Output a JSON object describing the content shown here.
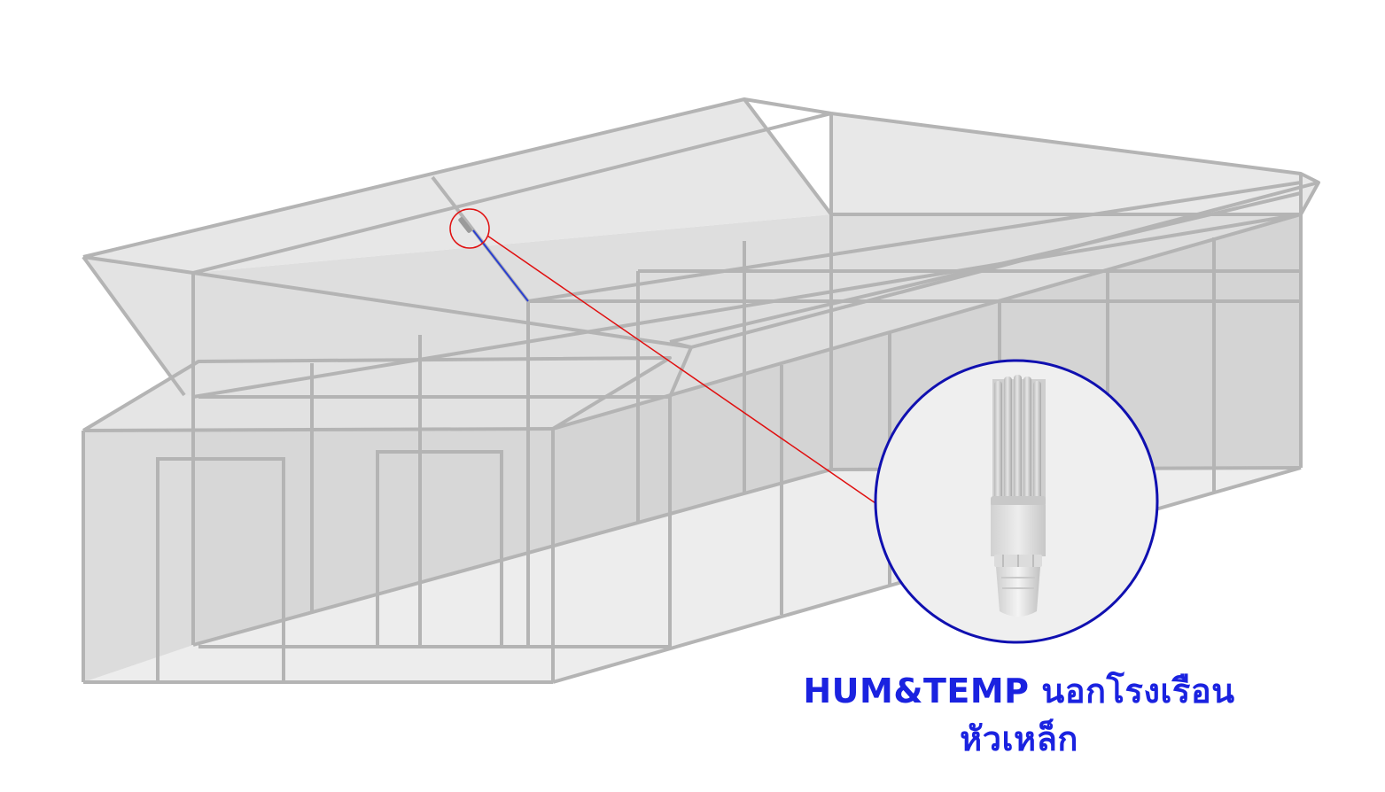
{
  "caption": {
    "line1": "HUM&TEMP นอกโรงเรือน",
    "line2": "หัวเหล็ก"
  },
  "colors": {
    "frame": "#b4b4b4",
    "panel_light": "#ececec",
    "panel_mid": "#dcdcdc",
    "panel_dark": "#cfcfcf",
    "callout_circle": "#1010b0",
    "leader_line": "#e01010",
    "sensor_cable": "#2a3fd0",
    "caption_text": "#1a22e0"
  },
  "icons": {
    "sensor": "humidity-temperature-sensor-probe"
  }
}
